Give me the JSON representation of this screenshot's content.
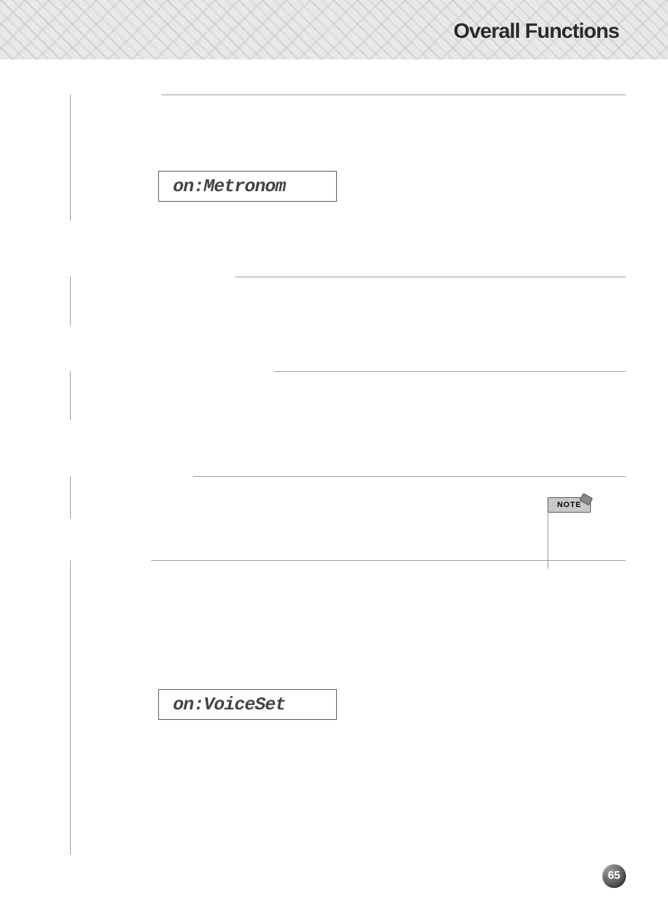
{
  "header": {
    "title": "Overall Functions"
  },
  "sections": [
    {
      "lcd_value": "on:Metronom"
    },
    {
      "lcd_value": "on:VoiceSet"
    }
  ],
  "note": {
    "label": "NOTE"
  },
  "page_number": "65"
}
